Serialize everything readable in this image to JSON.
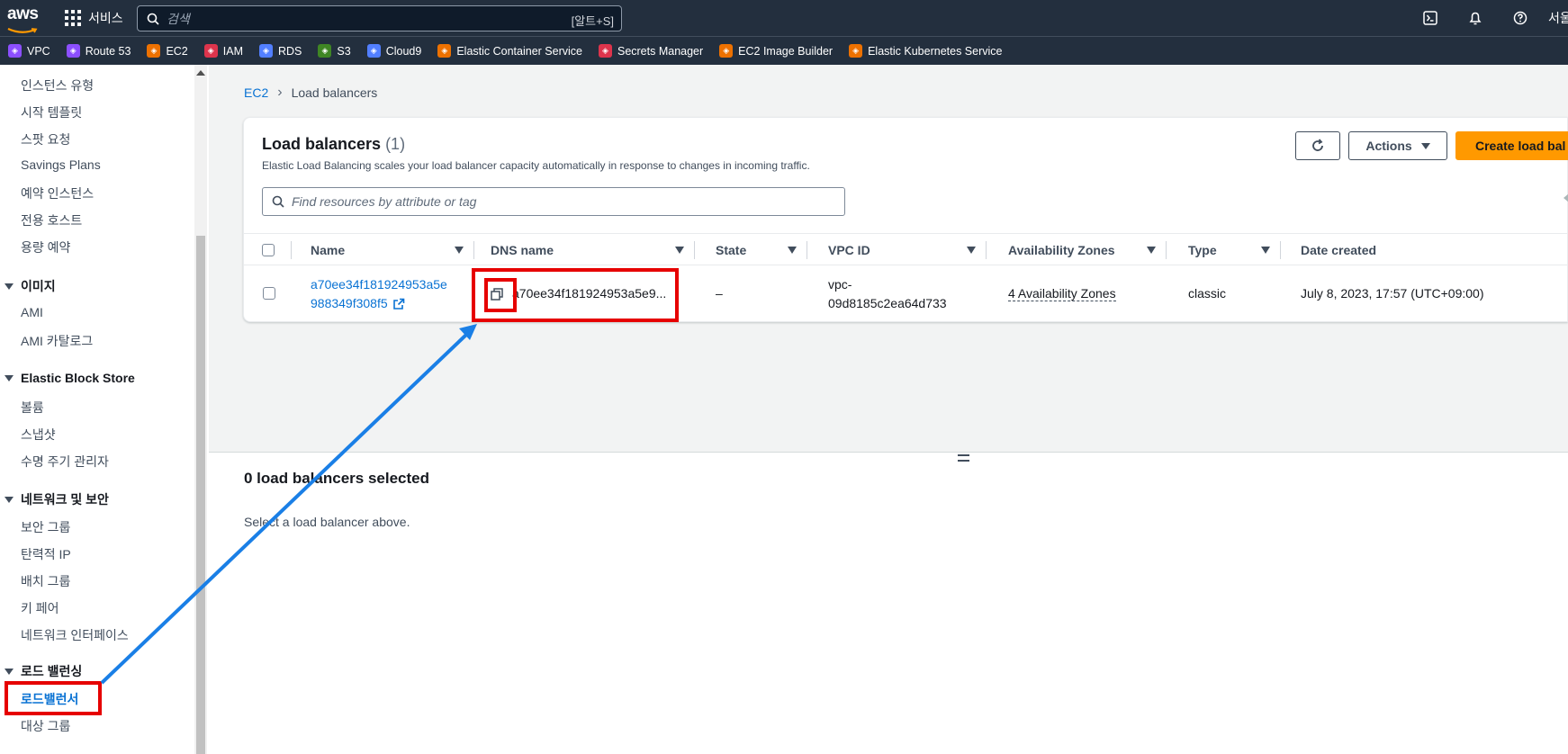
{
  "topbar": {
    "logo_text": "aws",
    "services_label": "서비스",
    "search_placeholder": "검색",
    "search_shortcut": "[알트+S]",
    "region_text": "서울"
  },
  "favorites": [
    {
      "label": "VPC",
      "color": "#8c4fff"
    },
    {
      "label": "Route 53",
      "color": "#8c4fff"
    },
    {
      "label": "EC2",
      "color": "#ed7100"
    },
    {
      "label": "IAM",
      "color": "#dd344c"
    },
    {
      "label": "RDS",
      "color": "#527fff"
    },
    {
      "label": "S3",
      "color": "#3f8624"
    },
    {
      "label": "Cloud9",
      "color": "#527fff"
    },
    {
      "label": "Elastic Container Service",
      "color": "#ed7100"
    },
    {
      "label": "Secrets Manager",
      "color": "#dd344c"
    },
    {
      "label": "EC2 Image Builder",
      "color": "#ed7100"
    },
    {
      "label": "Elastic Kubernetes Service",
      "color": "#ed7100"
    }
  ],
  "sidebar": {
    "items_top": [
      "인스턴스 유형",
      "시작 템플릿",
      "스팟 요청",
      "Savings Plans",
      "예약 인스턴스",
      "전용 호스트",
      "용량 예약"
    ],
    "section_images": "이미지",
    "items_images": [
      "AMI",
      "AMI 카탈로그"
    ],
    "section_ebs": "Elastic Block Store",
    "items_ebs": [
      "볼륨",
      "스냅샷",
      "수명 주기 관리자"
    ],
    "section_network": "네트워크 및 보안",
    "items_network": [
      "보안 그룹",
      "탄력적 IP",
      "배치 그룹",
      "키 페어",
      "네트워크 인터페이스"
    ],
    "section_lb": "로드 밸런싱",
    "items_lb": [
      "로드밸런서",
      "대상 그룹"
    ]
  },
  "breadcrumb": {
    "root": "EC2",
    "current": "Load balancers"
  },
  "panel": {
    "title": "Load balancers",
    "count": "(1)",
    "description": "Elastic Load Balancing scales your load balancer capacity automatically in response to changes in incoming traffic.",
    "actions_label": "Actions",
    "create_label": "Create load bal",
    "filter_placeholder": "Find resources by attribute or tag"
  },
  "table": {
    "headers": [
      "Name",
      "DNS name",
      "State",
      "VPC ID",
      "Availability Zones",
      "Type",
      "Date created"
    ],
    "row": {
      "name_line1": "a70ee34f181924953a5e",
      "name_line2": "988349f308f5",
      "dns": "a70ee34f181924953a5e9...",
      "state": "–",
      "vpc_line1": "vpc-",
      "vpc_line2": "09d8185c2ea64d733",
      "azs": "4 Availability Zones",
      "type": "classic",
      "date": "July 8, 2023, 17:57 (UTC+09:00)"
    }
  },
  "selection": {
    "title": "0 load balancers selected",
    "description": "Select a load balancer above."
  },
  "colors": {
    "nav_bg": "#232f3e",
    "link": "#0972d3",
    "primary_button": "#ff9900",
    "annotation": "#e60000",
    "annotation_arrow": "#1a7fe6"
  }
}
